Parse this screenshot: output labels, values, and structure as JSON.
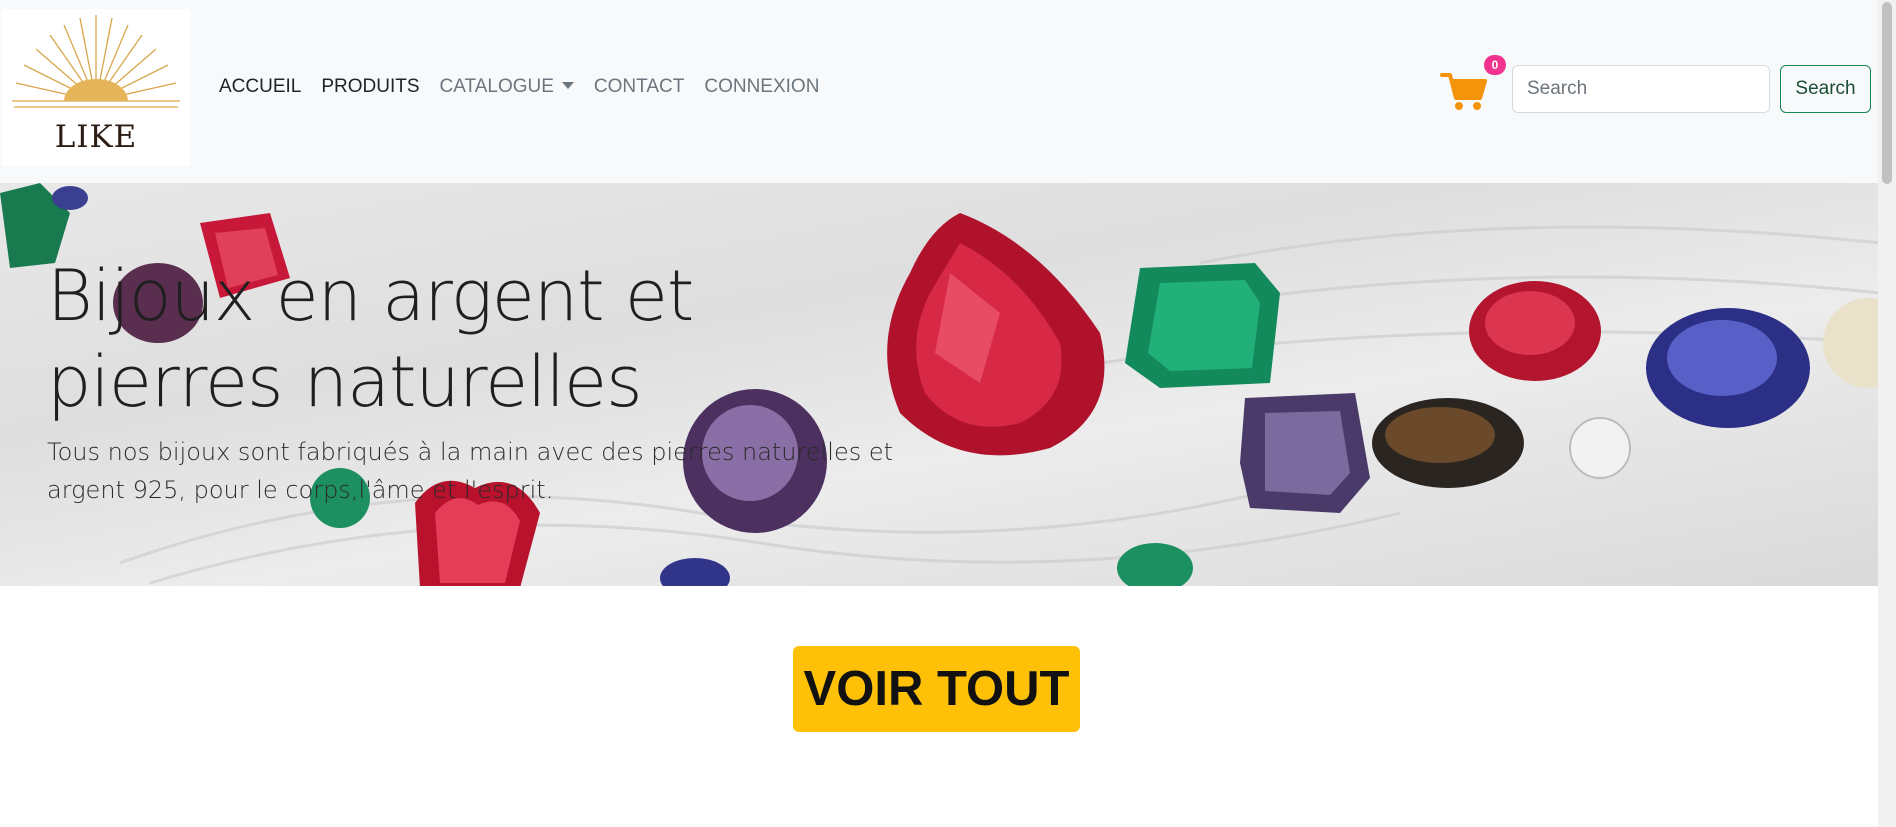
{
  "logo": {
    "text": "LIKE",
    "icon": "sunburst-logo-icon",
    "color": "#d9a64b"
  },
  "nav": {
    "items": [
      {
        "label": "ACCUEIL",
        "active": true
      },
      {
        "label": "PRODUITS",
        "active": true
      },
      {
        "label": "CATALOGUE",
        "active": false,
        "dropdown": true
      },
      {
        "label": "CONTACT",
        "active": false
      },
      {
        "label": "CONNEXION",
        "active": false
      }
    ]
  },
  "cart": {
    "icon": "shopping-cart-icon",
    "count": "0",
    "color": "#f5940a",
    "badge_color": "#f0338f"
  },
  "search": {
    "placeholder": "Search",
    "value": "",
    "button_label": "Search"
  },
  "hero": {
    "title": "Bijoux en argent et pierres naturelles",
    "text": "Tous nos bijoux sont fabriqués à la main avec des pierres naturelles et argent 925, pour le corps,l'âme et l'esprit."
  },
  "cta": {
    "label": "VOIR TOUT",
    "color": "#ffc107"
  }
}
